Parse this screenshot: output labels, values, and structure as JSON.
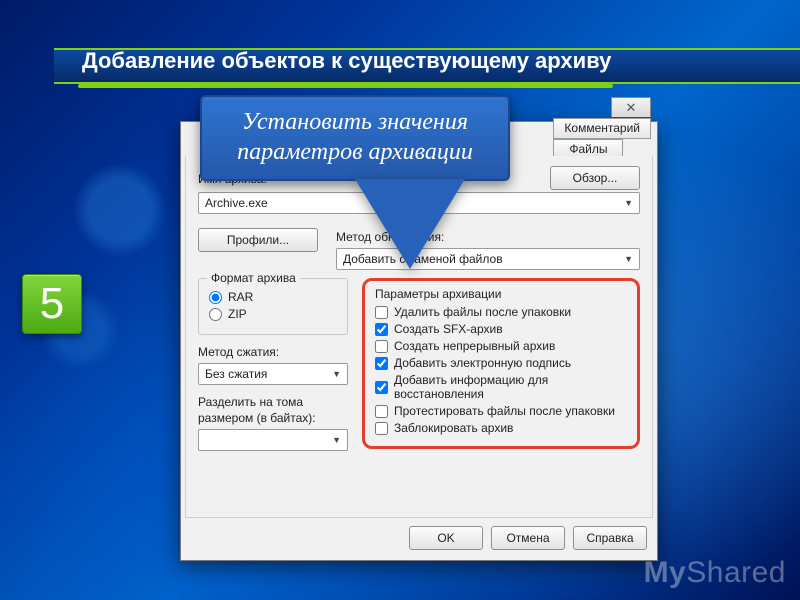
{
  "slide": {
    "title": "Добавление объектов к существующему архиву",
    "step_number": "5",
    "watermark_bold": "My",
    "watermark_rest": "Shared"
  },
  "callout": {
    "line1": "Установить значения",
    "line2": "параметров архивации"
  },
  "dialog": {
    "close_glyph": "✕",
    "tabs_row1": [
      "Комментарий"
    ],
    "tabs_row2": [
      "Файлы"
    ],
    "archive_name_label": "Имя архива:",
    "archive_name_value": "Archive.exe",
    "browse_btn": "Обзор...",
    "profiles_btn": "Профили...",
    "update_method_label": "Метод обновления:",
    "update_method_value": "Добавить с заменой файлов",
    "format_group": "Формат архива",
    "format_rar": "RAR",
    "format_zip": "ZIP",
    "compression_label": "Метод сжатия:",
    "compression_value": "Без сжатия",
    "split_label_l1": "Разделить на тома",
    "split_label_l2": "размером (в байтах):",
    "split_value": "",
    "params_group": "Параметры архивации",
    "checks": [
      {
        "label": "Удалить файлы после упаковки",
        "checked": false
      },
      {
        "label": "Создать SFX-архив",
        "checked": true
      },
      {
        "label": "Создать непрерывный архив",
        "checked": false
      },
      {
        "label": "Добавить электронную подпись",
        "checked": true
      },
      {
        "label": "Добавить информацию для восстановления",
        "checked": true
      },
      {
        "label": "Протестировать файлы после упаковки",
        "checked": false
      },
      {
        "label": "Заблокировать архив",
        "checked": false
      }
    ],
    "ok_btn": "OK",
    "cancel_btn": "Отмена",
    "help_btn": "Справка"
  }
}
